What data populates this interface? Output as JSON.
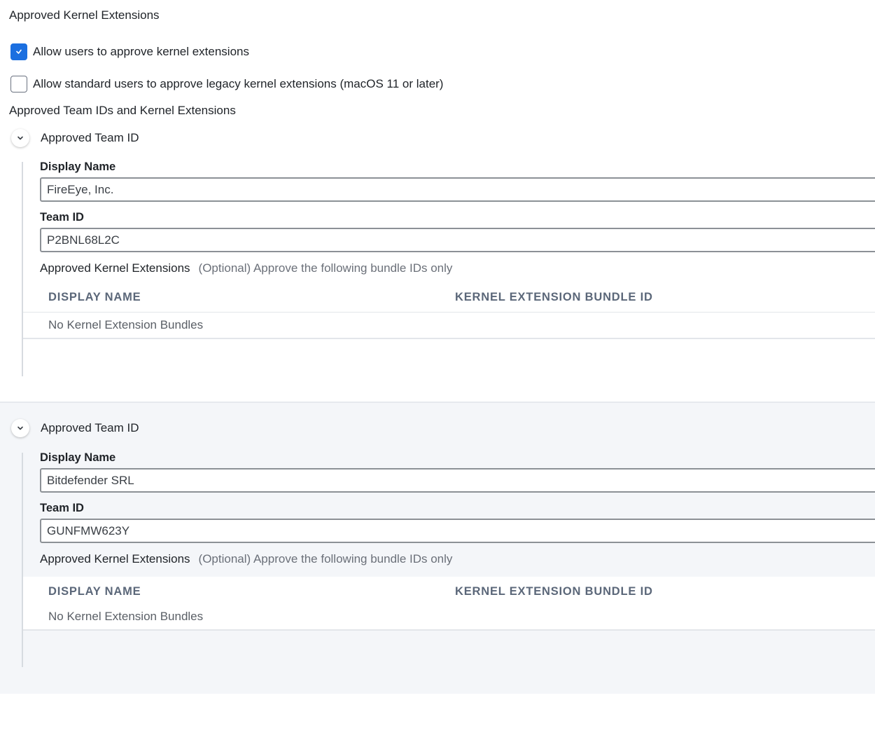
{
  "section_title": "Approved Kernel Extensions",
  "checkbox_allow_users": {
    "label": "Allow users to approve kernel extensions",
    "checked": true
  },
  "checkbox_allow_standard": {
    "label": "Allow standard users to approve legacy kernel extensions (macOS 11 or later)",
    "checked": false
  },
  "team_ids_title": "Approved Team IDs and Kernel Extensions",
  "accent_color": "#1b6fe0",
  "teams": [
    {
      "header": "Approved Team ID",
      "display_name_label": "Display Name",
      "display_name_value": "FireEye, Inc.",
      "team_id_label": "Team ID",
      "team_id_value": "P2BNL68L2C",
      "kext_label": "Approved Kernel Extensions",
      "kext_hint": "(Optional) Approve the following bundle IDs only",
      "columns": [
        "DISPLAY NAME",
        "KERNEL EXTENSION BUNDLE ID"
      ],
      "empty_text": "No Kernel Extension Bundles"
    },
    {
      "header": "Approved Team ID",
      "display_name_label": "Display Name",
      "display_name_value": "Bitdefender SRL",
      "team_id_label": "Team ID",
      "team_id_value": "GUNFMW623Y",
      "kext_label": "Approved Kernel Extensions",
      "kext_hint": "(Optional) Approve the following bundle IDs only",
      "columns": [
        "DISPLAY NAME",
        "KERNEL EXTENSION BUNDLE ID"
      ],
      "empty_text": "No Kernel Extension Bundles"
    }
  ]
}
